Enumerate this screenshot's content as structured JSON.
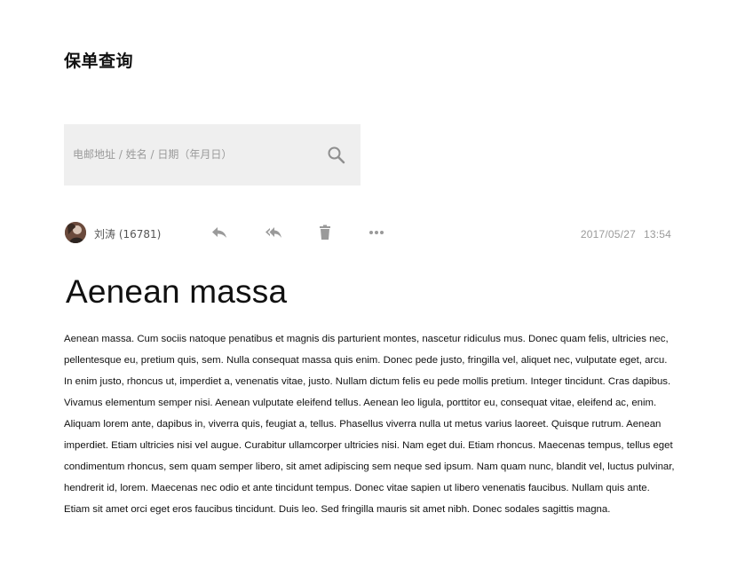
{
  "page": {
    "title": "保单查询"
  },
  "search": {
    "placeholder": "电邮地址 / 姓名 / 日期（年月日）",
    "value": ""
  },
  "message": {
    "sender": "刘涛 (16781)",
    "date": "2017/05/27",
    "time": "13:54",
    "title": "Aenean massa",
    "body": "Aenean massa. Cum sociis natoque penatibus et magnis dis parturient montes, nascetur ridiculus mus. Donec quam felis, ultricies nec, pellentesque eu, pretium quis, sem. Nulla consequat massa quis enim. Donec pede justo, fringilla vel, aliquet nec, vulputate eget, arcu. In enim justo, rhoncus ut, imperdiet a, venenatis vitae, justo. Nullam dictum felis eu pede mollis pretium. Integer tincidunt. Cras dapibus. Vivamus elementum semper nisi. Aenean vulputate eleifend tellus. Aenean leo ligula, porttitor eu, consequat vitae, eleifend ac, enim. Aliquam lorem ante, dapibus in, viverra quis, feugiat a, tellus. Phasellus viverra nulla ut metus varius laoreet. Quisque rutrum. Aenean imperdiet. Etiam ultricies nisi vel augue. Curabitur ullamcorper ultricies nisi. Nam eget dui. Etiam rhoncus. Maecenas tempus, tellus eget condimentum rhoncus, sem quam semper libero, sit amet adipiscing sem neque sed ipsum. Nam quam nunc, blandit vel, luctus pulvinar, hendrerit id, lorem. Maecenas nec odio et ante tincidunt tempus. Donec vitae sapien ut libero venenatis faucibus. Nullam quis ante. Etiam sit amet orci eget eros faucibus tincidunt. Duis leo. Sed fringilla mauris sit amet nibh. Donec sodales sagittis magna."
  },
  "icons": {
    "search": "search-icon",
    "reply": "reply-icon",
    "reply_all": "reply-all-icon",
    "delete": "trash-icon",
    "more": "more-icon"
  },
  "colors": {
    "search_bg": "#efefef",
    "icon_gray": "#9a9a9a",
    "text": "#111111",
    "muted": "#9a9a9a"
  }
}
